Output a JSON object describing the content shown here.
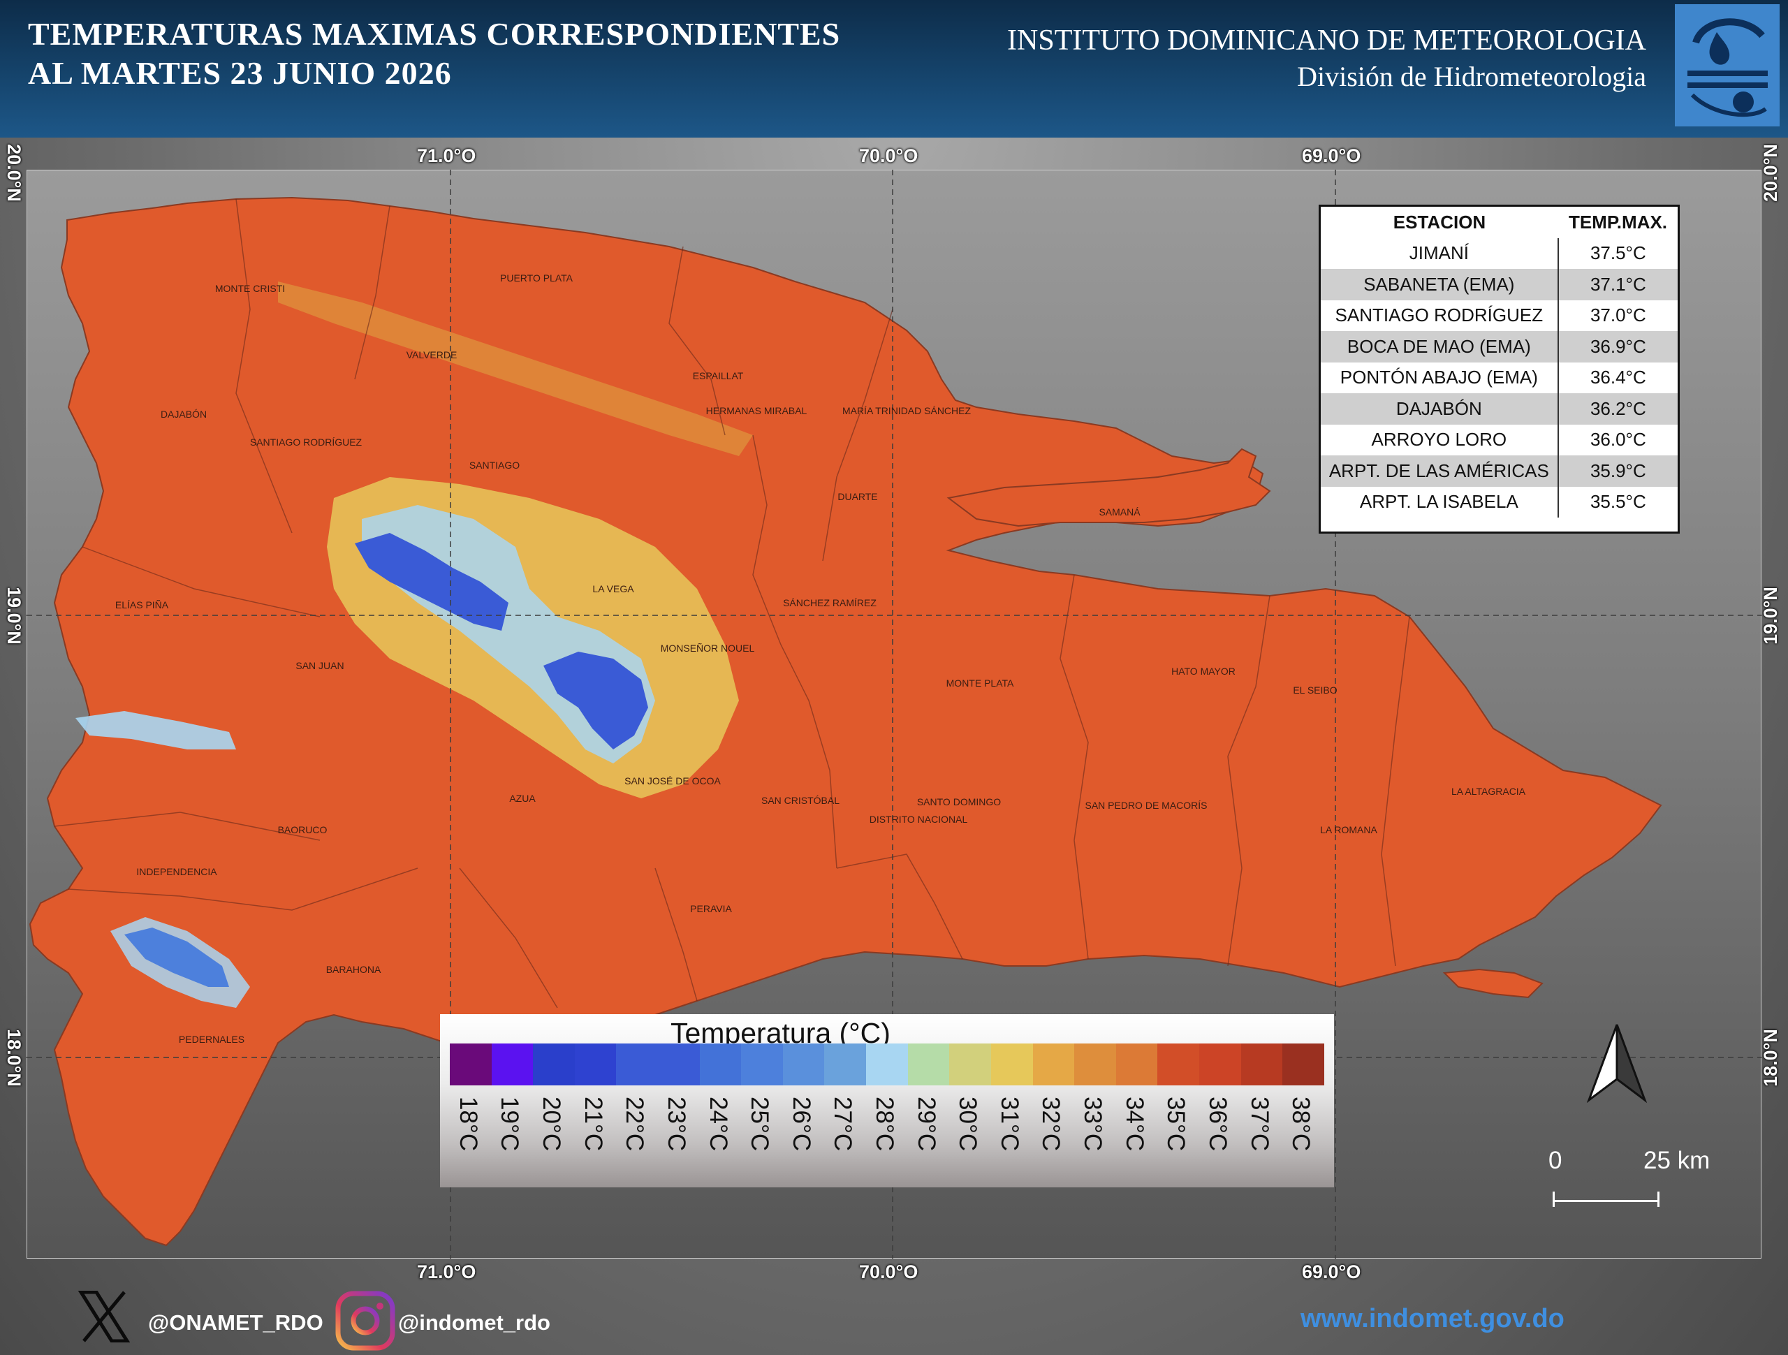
{
  "header": {
    "title_line1": "TEMPERATURAS MAXIMAS CORRESPONDIENTES",
    "title_line2": "AL MARTES 23  JUNIO 2026",
    "org_name": "INSTITUTO DOMINICANO DE METEOROLOGIA",
    "org_division": "División de Hidrometeorologia",
    "colors": {
      "header_dark": "#0d2c49",
      "header_light": "#1d5788",
      "logo_blue": "#3f86cc"
    }
  },
  "map": {
    "longitude_labels": [
      "71.0°O",
      "70.0°O",
      "69.0°O"
    ],
    "latitude_labels": [
      "20.0°N",
      "19.0°N",
      "18.0°N"
    ],
    "province_labels": [
      "MONTE CRISTI",
      "PUERTO PLATA",
      "VALVERDE",
      "ESPAILLAT",
      "HERMANAS MIRABAL",
      "MARÍA TRINIDAD SÁNCHEZ",
      "DAJABÓN",
      "SANTIAGO RODRÍGUEZ",
      "SANTIAGO",
      "DUARTE",
      "SAMANÁ",
      "ELÍAS PIÑA",
      "LA VEGA",
      "SÁNCHEZ RAMÍREZ",
      "MONSEÑOR NOUEL",
      "SAN JUAN",
      "MONTE PLATA",
      "HATO MAYOR",
      "EL SEIBO",
      "AZUA",
      "SAN JOSÉ DE OCOA",
      "SAN CRISTÓBAL",
      "SANTO DOMINGO",
      "DISTRITO NACIONAL",
      "SAN PEDRO DE MACORÍS",
      "LA ROMANA",
      "LA ALTAGRACIA",
      "BAORUCO",
      "INDEPENDENCIA",
      "BARAHONA",
      "PERAVIA",
      "PEDERNALES"
    ]
  },
  "stations": {
    "header_station": "ESTACION",
    "header_value": "TEMP.MAX.",
    "rows": [
      {
        "name": "JIMANÍ",
        "value": "37.5°C"
      },
      {
        "name": "SABANETA (EMA)",
        "value": "37.1°C"
      },
      {
        "name": "SANTIAGO RODRÍGUEZ",
        "value": "37.0°C"
      },
      {
        "name": "BOCA DE MAO (EMA)",
        "value": "36.9°C"
      },
      {
        "name": "PONTÓN ABAJO (EMA)",
        "value": "36.4°C"
      },
      {
        "name": "DAJABÓN",
        "value": "36.2°C"
      },
      {
        "name": "ARROYO LORO",
        "value": "36.0°C"
      },
      {
        "name": "ARPT. DE LAS AMÉRICAS",
        "value": "35.9°C"
      },
      {
        "name": "ARPT. LA ISABELA",
        "value": "35.5°C"
      }
    ]
  },
  "legend": {
    "title": "Temperatura (°C)",
    "items": [
      {
        "label": "18°C",
        "color": "#6a0a7a"
      },
      {
        "label": "19°C",
        "color": "#5b12f0"
      },
      {
        "label": "20°C",
        "color": "#2a3fcb"
      },
      {
        "label": "21°C",
        "color": "#2e42d0"
      },
      {
        "label": "22°C",
        "color": "#3a5bd6"
      },
      {
        "label": "23°C",
        "color": "#3a5bd6"
      },
      {
        "label": "24°C",
        "color": "#4372d8"
      },
      {
        "label": "25°C",
        "color": "#4d80dc"
      },
      {
        "label": "26°C",
        "color": "#5a90dc"
      },
      {
        "label": "27°C",
        "color": "#6aa2dc"
      },
      {
        "label": "28°C",
        "color": "#a8d6f2"
      },
      {
        "label": "29°C",
        "color": "#b5dca8"
      },
      {
        "label": "30°C",
        "color": "#d2d07c"
      },
      {
        "label": "31°C",
        "color": "#e6c85a"
      },
      {
        "label": "32°C",
        "color": "#e5a846"
      },
      {
        "label": "33°C",
        "color": "#de8e3c"
      },
      {
        "label": "34°C",
        "color": "#dc7a36"
      },
      {
        "label": "35°C",
        "color": "#d24e28"
      },
      {
        "label": "36°C",
        "color": "#cc4426"
      },
      {
        "label": "37°C",
        "color": "#b73a22"
      },
      {
        "label": "38°C",
        "color": "#9a3020"
      }
    ]
  },
  "scale_bar": {
    "start": "0",
    "end": "25 km"
  },
  "footer": {
    "x_handle": "@ONAMET_RDO",
    "instagram_handle": "@indomet_rdo",
    "website": "www.indomet.gov.do"
  }
}
